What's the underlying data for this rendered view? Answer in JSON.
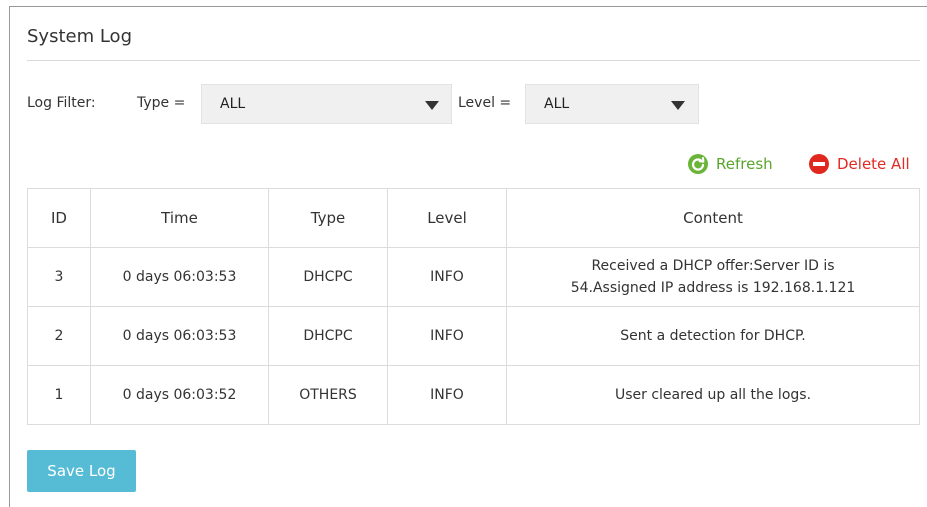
{
  "page": {
    "title": "System Log"
  },
  "filter": {
    "label": "Log Filter:",
    "type_label": "Type =",
    "type_value": "ALL",
    "level_label": "Level =",
    "level_value": "ALL"
  },
  "actions": {
    "refresh_label": "Refresh",
    "refresh_icon": "refresh-icon",
    "delete_all_label": "Delete All",
    "delete_icon": "minus-circle-icon"
  },
  "table": {
    "columns": [
      "ID",
      "Time",
      "Type",
      "Level",
      "Content"
    ],
    "rows": [
      {
        "id": "3",
        "time": "0 days 06:03:53",
        "type": "DHCPC",
        "level": "INFO",
        "content_line1": "Received a DHCP offer:Server ID is",
        "content_line2": "54.Assigned IP address is 192.168.1.121"
      },
      {
        "id": "2",
        "time": "0 days 06:03:53",
        "type": "DHCPC",
        "level": "INFO",
        "content_line1": "Sent a detection for DHCP.",
        "content_line2": ""
      },
      {
        "id": "1",
        "time": "0 days 06:03:52",
        "type": "OTHERS",
        "level": "INFO",
        "content_line1": "User cleared up all the logs.",
        "content_line2": ""
      }
    ]
  },
  "save_button": {
    "label": "Save Log"
  },
  "colors": {
    "refresh": "#5aa52e",
    "delete": "#e02a22",
    "save_button": "#56bbd5"
  }
}
